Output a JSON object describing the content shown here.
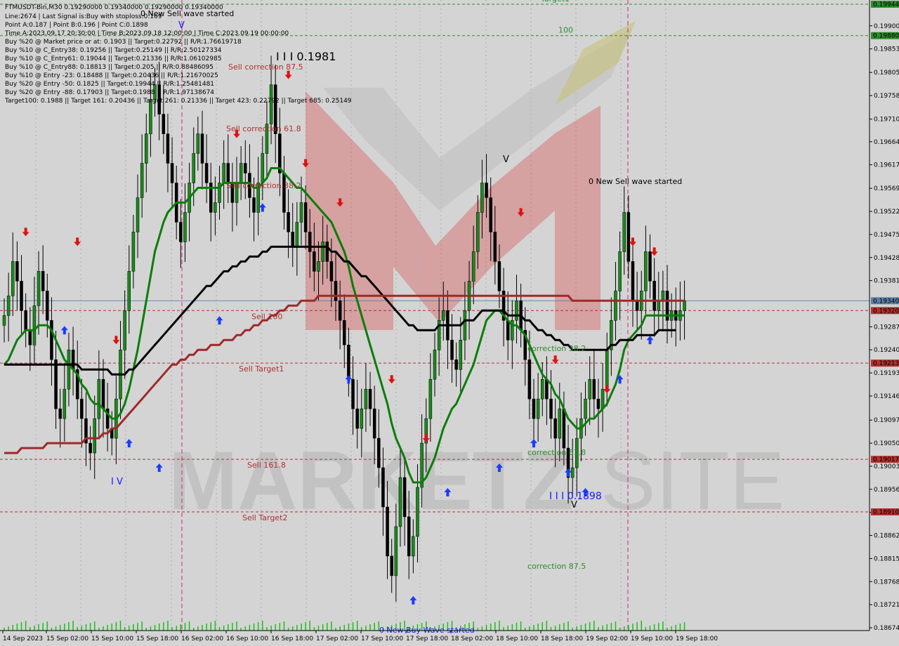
{
  "header": {
    "symbol_line": "FTMUSDT-Bin,M30  0.19290000 0.19340000 0.19290000 0.19340000",
    "lines": [
      "Line:2674 | Last Signal is:Buy with stoploss:0.169",
      "Point A:0.187 | Point B:0.196 | Point C:0.1898",
      "Time A:2023.09.17 20:30:00 | Time B:2023.09.18 12:00:00 | Time C:2023.09.19 00:00:00",
      "Buy %20 @ Market price or at: 0.1903 || Target:0.22792 || R/R:1.76619718",
      "Buy %10 @ C_Entry38: 0.19256 || Target:0.25149 || R/R:2.50127334",
      "Buy %10 @ C_Entry61: 0.19044 || Target:0.21336 || R/R:1.06102985",
      "Buy %10 @ C_Entry88: 0.18813 || Target:0.205 || R/R:0.88486095",
      "Buy %10 @ Entry -23: 0.18488 || Target:0.20436 || R/R:1.21670025",
      "Buy %20 @ Entry -50: 0.1825 || Target:0.19944 || R/R:1.25481481",
      "Buy %20 @ Entry -88: 0.17903 || Target:0.1988 || R/R:1.97138674",
      "Target100: 0.1988 || Target 161: 0.20436 || Target 261: 0.21336 || Target 423: 0.22792 || Target 685: 0.25149"
    ]
  },
  "watermark": {
    "bold": "MARKETZ",
    "light": "SITE"
  },
  "levels": [
    {
      "price": 0.19944,
      "color": "#2e8b2e",
      "label": "Target1",
      "label_color": "#2e8b2e",
      "tag": "0.19944"
    },
    {
      "price": 0.1988,
      "color": "#2e8b2e",
      "label": "100",
      "label_color": "#2e8b2e",
      "tag": "0.19880"
    },
    {
      "price": 0.1934,
      "color": "#5b7fa6",
      "label": "",
      "label_color": "#000",
      "tag": "0.19340",
      "solid": true
    },
    {
      "price": 0.1932,
      "color": "#b03030",
      "label": "Sell 100",
      "label_color": "#b03030",
      "tag": "0.19320"
    },
    {
      "price": 0.19213,
      "color": "#b03030",
      "label": "Sell Target1",
      "label_color": "#b03030",
      "tag": "0.19213"
    },
    {
      "price": 0.19017,
      "color": "#b03030",
      "label": "Sell 161.8",
      "label_color": "#b03030",
      "tag": "0.19017"
    },
    {
      "price": 0.1891,
      "color": "#b03030",
      "label": "Sell Target2",
      "label_color": "#b03030",
      "tag": "0.18910"
    }
  ],
  "annotations": [
    {
      "text": "0 New Sell wave started",
      "color": "#000"
    },
    {
      "text": "I I I 0.1981",
      "color": "#000"
    },
    {
      "text": "Sell correction 87.5",
      "color": "#b03030"
    },
    {
      "text": "Sell correction 61.8",
      "color": "#b03030"
    },
    {
      "text": "Sell correction 38.2",
      "color": "#b03030"
    },
    {
      "text": "0 New Sell wave started",
      "color": "#000"
    },
    {
      "text": "correction 38.2",
      "color": "#2e8b2e"
    },
    {
      "text": "correction 61.8",
      "color": "#2e8b2e"
    },
    {
      "text": "I I I 0.1898",
      "color": "#1a1aff"
    },
    {
      "text": "correction 87.5",
      "color": "#2e8b2e"
    },
    {
      "text": "0 New Buy Wave started",
      "color": "#1a1aff"
    },
    {
      "text": "I V",
      "color": "#1a1aff"
    },
    {
      "text": "V",
      "color": "#1a1aff"
    },
    {
      "text": "V",
      "color": "#000"
    },
    {
      "text": "V",
      "color": "#000"
    }
  ],
  "colors": {
    "bull": "#1a8a1a",
    "bear": "#000000",
    "ma_fast": "#0a7d0a",
    "ma_mid": "#000000",
    "ma_slow": "#a02828",
    "buy_arrow": "#1a3cff",
    "sell_arrow": "#e01010"
  },
  "chart_data": {
    "type": "candlestick",
    "symbol": "FTMUSDT-Bin",
    "timeframe": "M30",
    "ylim": [
      0.18674,
      0.19944
    ],
    "y_ticks": [
      "0.19900",
      "0.19853",
      "0.19805",
      "0.19758",
      "0.19710",
      "0.19664",
      "0.19617",
      "0.19569",
      "0.19522",
      "0.19475",
      "0.19428",
      "0.19381",
      "0.19287",
      "0.19240",
      "0.19193",
      "0.19146",
      "0.19097",
      "0.19050",
      "0.19003",
      "0.18956",
      "0.18909",
      "0.18862",
      "0.18815",
      "0.18768",
      "0.18721",
      "0.18674"
    ],
    "x_ticks": [
      "14 Sep 2023",
      "15 Sep 02:00",
      "15 Sep 10:00",
      "15 Sep 18:00",
      "16 Sep 02:00",
      "16 Sep 10:00",
      "16 Sep 18:00",
      "17 Sep 02:00",
      "17 Sep 10:00",
      "17 Sep 18:00",
      "18 Sep 02:00",
      "18 Sep 10:00",
      "18 Sep 18:00",
      "19 Sep 02:00",
      "19 Sep 10:00",
      "19 Sep 18:00"
    ],
    "close": [
      0.1931,
      0.1935,
      0.1942,
      0.1938,
      0.1932,
      0.1928,
      0.1925,
      0.1933,
      0.194,
      0.1936,
      0.193,
      0.1922,
      0.1912,
      0.191,
      0.1916,
      0.1924,
      0.192,
      0.1914,
      0.191,
      0.1905,
      0.1903,
      0.191,
      0.1918,
      0.1912,
      0.1908,
      0.1906,
      0.1914,
      0.1924,
      0.1932,
      0.194,
      0.1948,
      0.1955,
      0.1962,
      0.1968,
      0.1975,
      0.1978,
      0.1972,
      0.1968,
      0.1962,
      0.1958,
      0.195,
      0.1946,
      0.1952,
      0.1958,
      0.1964,
      0.1968,
      0.1962,
      0.1958,
      0.1952,
      0.1954,
      0.1958,
      0.1962,
      0.1958,
      0.1954,
      0.1958,
      0.1962,
      0.196,
      0.1955,
      0.1952,
      0.1958,
      0.1964,
      0.197,
      0.1978,
      0.1968,
      0.196,
      0.1952,
      0.1948,
      0.1945,
      0.195,
      0.1954,
      0.1948,
      0.1944,
      0.194,
      0.1942,
      0.1946,
      0.1942,
      0.1938,
      0.1934,
      0.193,
      0.1925,
      0.1918,
      0.1912,
      0.1908,
      0.1912,
      0.1916,
      0.1912,
      0.1906,
      0.19,
      0.1892,
      0.1882,
      0.1878,
      0.1888,
      0.1898,
      0.189,
      0.1882,
      0.1886,
      0.1896,
      0.1905,
      0.191,
      0.1918,
      0.1924,
      0.193,
      0.1932,
      0.1926,
      0.1922,
      0.192,
      0.1926,
      0.1932,
      0.1938,
      0.1944,
      0.1952,
      0.1958,
      0.1955,
      0.1948,
      0.1942,
      0.1936,
      0.193,
      0.1926,
      0.193,
      0.1934,
      0.1928,
      0.1922,
      0.1914,
      0.191,
      0.1914,
      0.1918,
      0.1914,
      0.191,
      0.1906,
      0.1912,
      0.1904,
      0.1898,
      0.19,
      0.1906,
      0.191,
      0.1914,
      0.1918,
      0.1914,
      0.1912,
      0.1916,
      0.1924,
      0.193,
      0.1936,
      0.1944,
      0.1952,
      0.1942,
      0.1934,
      0.1932,
      0.1936,
      0.1944,
      0.1938,
      0.1932,
      0.1934,
      0.1936,
      0.193,
      0.1932,
      0.193,
      0.1932,
      0.1934
    ],
    "series": [
      {
        "name": "ma_fast",
        "values": [
          0.1921,
          0.1922,
          0.1924,
          0.1926,
          0.1927,
          0.1928,
          0.1928,
          0.1928,
          0.1929,
          0.1929,
          0.1929,
          0.1928,
          0.1926,
          0.1924,
          0.1922,
          0.1921,
          0.192,
          0.1919,
          0.1917,
          0.1916,
          0.1914,
          0.1913,
          0.1913,
          0.1912,
          0.1911,
          0.191,
          0.191,
          0.1911,
          0.1913,
          0.1916,
          0.192,
          0.1924,
          0.1929,
          0.1934,
          0.1939,
          0.1944,
          0.1947,
          0.195,
          0.1952,
          0.1953,
          0.1954,
          0.1954,
          0.1954,
          0.1955,
          0.1956,
          0.1957,
          0.1957,
          0.1957,
          0.1957,
          0.1957,
          0.1957,
          0.1958,
          0.1958,
          0.1958,
          0.1958,
          0.1958,
          0.1958,
          0.1958,
          0.1957,
          0.1957,
          0.1958,
          0.1959,
          0.1961,
          0.1961,
          0.1961,
          0.196,
          0.1959,
          0.1958,
          0.1957,
          0.1957,
          0.1956,
          0.1955,
          0.1954,
          0.1953,
          0.1952,
          0.1951,
          0.195,
          0.1948,
          0.1946,
          0.1944,
          0.1941,
          0.1937,
          0.1934,
          0.1931,
          0.1928,
          0.1925,
          0.1922,
          0.1919,
          0.1916,
          0.1913,
          0.1909,
          0.1906,
          0.1904,
          0.1902,
          0.1899,
          0.1897,
          0.1897,
          0.1897,
          0.1898,
          0.19,
          0.1902,
          0.1905,
          0.1908,
          0.191,
          0.1912,
          0.1913,
          0.1915,
          0.1917,
          0.1919,
          0.1921,
          0.1924,
          0.1927,
          0.193,
          0.1931,
          0.1932,
          0.1932,
          0.1931,
          0.193,
          0.1929,
          0.1929,
          0.1928,
          0.1927,
          0.1925,
          0.1923,
          0.1921,
          0.1919,
          0.1918,
          0.1917,
          0.1915,
          0.1914,
          0.1912,
          0.191,
          0.1909,
          0.1908,
          0.1908,
          0.1909,
          0.191,
          0.191,
          0.1911,
          0.1912,
          0.1913,
          0.1915,
          0.1917,
          0.192,
          0.1924,
          0.1926,
          0.1927,
          0.1928,
          0.1929,
          0.1931,
          0.1931,
          0.1931,
          0.1931,
          0.1931,
          0.1931,
          0.1931,
          0.1931,
          0.1931,
          0.1931
        ]
      },
      {
        "name": "ma_mid",
        "values": [
          0.1921,
          0.1921,
          0.1921,
          0.1921,
          0.1921,
          0.1921,
          0.1921,
          0.1921,
          0.1921,
          0.1921,
          0.1921,
          0.1921,
          0.1921,
          0.1921,
          0.1921,
          0.1921,
          0.1921,
          0.1921,
          0.192,
          0.192,
          0.192,
          0.192,
          0.192,
          0.192,
          0.192,
          0.1919,
          0.1919,
          0.1919,
          0.1919,
          0.192,
          0.192,
          0.1921,
          0.1922,
          0.1923,
          0.1924,
          0.1925,
          0.1926,
          0.1927,
          0.1928,
          0.1929,
          0.193,
          0.1931,
          0.1932,
          0.1933,
          0.1934,
          0.1935,
          0.1936,
          0.1937,
          0.1937,
          0.1938,
          0.1939,
          0.194,
          0.194,
          0.1941,
          0.1941,
          0.1942,
          0.1942,
          0.1943,
          0.1943,
          0.1943,
          0.1944,
          0.1944,
          0.1945,
          0.1945,
          0.1945,
          0.1945,
          0.1945,
          0.1945,
          0.1945,
          0.1945,
          0.1945,
          0.1945,
          0.1945,
          0.1945,
          0.1945,
          0.1945,
          0.1944,
          0.1944,
          0.1943,
          0.1942,
          0.1942,
          0.1941,
          0.194,
          0.1939,
          0.1939,
          0.1938,
          0.1937,
          0.1936,
          0.1935,
          0.1934,
          0.1933,
          0.1932,
          0.1931,
          0.193,
          0.1929,
          0.1929,
          0.1928,
          0.1928,
          0.1928,
          0.1928,
          0.1928,
          0.1929,
          0.1929,
          0.1929,
          0.1929,
          0.1929,
          0.1929,
          0.193,
          0.193,
          0.193,
          0.1931,
          0.1932,
          0.1932,
          0.1932,
          0.1932,
          0.1932,
          0.1932,
          0.1931,
          0.1931,
          0.1931,
          0.1931,
          0.193,
          0.193,
          0.1929,
          0.1928,
          0.1928,
          0.1927,
          0.1927,
          0.1926,
          0.1926,
          0.1925,
          0.1925,
          0.1924,
          0.1924,
          0.1924,
          0.1924,
          0.1924,
          0.1924,
          0.1924,
          0.1924,
          0.1924,
          0.1925,
          0.1925,
          0.1926,
          0.1926,
          0.1926,
          0.1926,
          0.1927,
          0.1927,
          0.1927,
          0.1927,
          0.1927,
          0.1928,
          0.1928,
          0.1928,
          0.1928,
          0.1928
        ]
      },
      {
        "name": "ma_slow",
        "values": [
          0.1903,
          0.1903,
          0.1903,
          0.1903,
          0.1904,
          0.1904,
          0.1904,
          0.1904,
          0.1904,
          0.1904,
          0.1905,
          0.1905,
          0.1905,
          0.1905,
          0.1905,
          0.1905,
          0.1905,
          0.1905,
          0.1905,
          0.1906,
          0.1906,
          0.1906,
          0.1906,
          0.1907,
          0.1907,
          0.1908,
          0.1908,
          0.1909,
          0.191,
          0.1911,
          0.1912,
          0.1913,
          0.1914,
          0.1915,
          0.1916,
          0.1917,
          0.1918,
          0.1919,
          0.192,
          0.1921,
          0.1921,
          0.1922,
          0.1922,
          0.1923,
          0.1923,
          0.1924,
          0.1924,
          0.1924,
          0.1925,
          0.1925,
          0.1925,
          0.1926,
          0.1926,
          0.1926,
          0.1927,
          0.1927,
          0.1928,
          0.1928,
          0.1929,
          0.1929,
          0.193,
          0.193,
          0.1931,
          0.1931,
          0.1932,
          0.1932,
          0.1933,
          0.1933,
          0.1933,
          0.1934,
          0.1934,
          0.1934,
          0.1934,
          0.1935,
          0.1935,
          0.1935,
          0.1935,
          0.1935,
          0.1935,
          0.1935,
          0.1935,
          0.1935,
          0.1935,
          0.1935,
          0.1935,
          0.1935,
          0.1935,
          0.1935,
          0.1935,
          0.1935,
          0.1935,
          0.1935,
          0.1935,
          0.1935,
          0.1935,
          0.1935,
          0.1935,
          0.1935,
          0.1935,
          0.1935,
          0.1935,
          0.1935,
          0.1935,
          0.1935,
          0.1935,
          0.1935,
          0.1935,
          0.1935,
          0.1935,
          0.1935,
          0.1935,
          0.1935,
          0.1935,
          0.1935,
          0.1935,
          0.1935,
          0.1935,
          0.1935,
          0.1935,
          0.1935,
          0.1935,
          0.1935,
          0.1935,
          0.1935,
          0.1935,
          0.1935,
          0.1935,
          0.1935,
          0.1935,
          0.1935,
          0.1935,
          0.1935,
          0.1934,
          0.1934,
          0.1934,
          0.1934,
          0.1934,
          0.1934,
          0.1934,
          0.1934,
          0.1934,
          0.1934,
          0.1934,
          0.1934,
          0.1934,
          0.1934,
          0.1934,
          0.1934,
          0.1934,
          0.1934,
          0.1934,
          0.1934,
          0.1934,
          0.1934,
          0.1934,
          0.1934,
          0.1934,
          0.1934,
          0.1934
        ]
      }
    ],
    "grid": true
  }
}
